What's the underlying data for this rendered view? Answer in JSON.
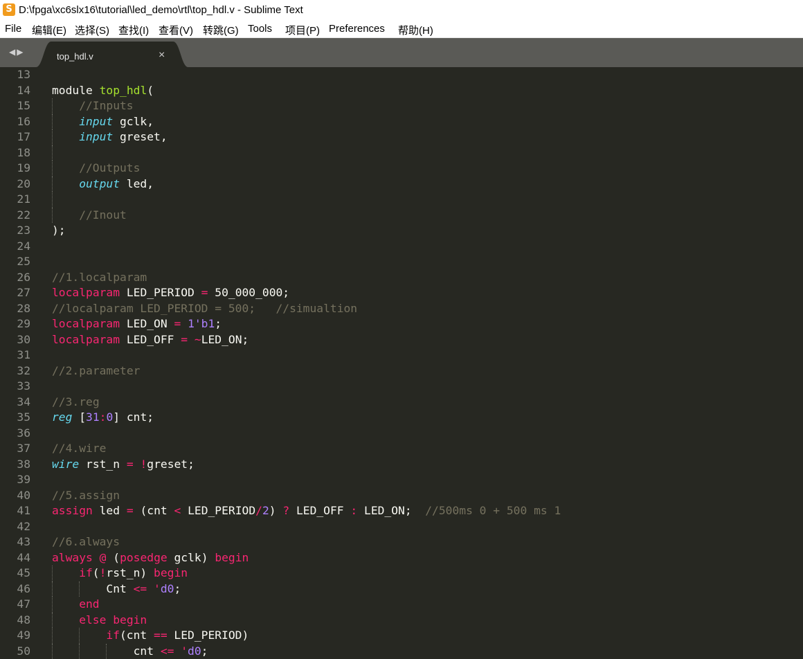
{
  "window": {
    "title": "D:\\fpga\\xc6slx16\\tutorial\\led_demo\\rtl\\top_hdl.v - Sublime Text",
    "icon_name": "sublime-text-logo-icon"
  },
  "menu": [
    "File",
    "编辑(E)",
    "选择(S)",
    "查找(I)",
    "查看(V)",
    "转跳(G)",
    "Tools",
    "项目(P)",
    "Preferences",
    "帮助(H)"
  ],
  "tabbar": {
    "nav_icon_names": [
      "left-arrow-icon",
      "right-arrow-icon"
    ],
    "tab_label": "top_hdl.v",
    "close_icon": "close-icon"
  },
  "colors": {
    "background": "#272822",
    "keyword": "#f92672",
    "storage": "#66d9ef",
    "function": "#a6e22e",
    "comment": "#75715e",
    "number": "#ae81ff",
    "text": "#f8f8f2"
  },
  "lines": [
    {
      "n": "13",
      "indent": 0,
      "tokens": []
    },
    {
      "n": "14",
      "indent": 0,
      "tokens": [
        [
          "t",
          "module "
        ],
        [
          "fn",
          "top_hdl"
        ],
        [
          "t",
          "("
        ]
      ]
    },
    {
      "n": "15",
      "indent": 1,
      "tokens": [
        [
          "cm",
          "//Inputs"
        ]
      ]
    },
    {
      "n": "16",
      "indent": 1,
      "tokens": [
        [
          "st",
          "input"
        ],
        [
          "t",
          " gclk,"
        ]
      ]
    },
    {
      "n": "17",
      "indent": 1,
      "tokens": [
        [
          "st",
          "input"
        ],
        [
          "t",
          " greset,"
        ]
      ]
    },
    {
      "n": "18",
      "indent": 1,
      "tokens": []
    },
    {
      "n": "19",
      "indent": 1,
      "tokens": [
        [
          "cm",
          "//Outputs"
        ]
      ]
    },
    {
      "n": "20",
      "indent": 1,
      "tokens": [
        [
          "st",
          "output"
        ],
        [
          "t",
          " led,"
        ]
      ]
    },
    {
      "n": "21",
      "indent": 1,
      "tokens": []
    },
    {
      "n": "22",
      "indent": 1,
      "tokens": [
        [
          "cm",
          "//Inout"
        ]
      ]
    },
    {
      "n": "23",
      "indent": 0,
      "tokens": [
        [
          "t",
          ");"
        ]
      ]
    },
    {
      "n": "24",
      "indent": 0,
      "tokens": []
    },
    {
      "n": "25",
      "indent": 0,
      "tokens": []
    },
    {
      "n": "26",
      "indent": 0,
      "tokens": [
        [
          "cm",
          "//1.localparam"
        ]
      ]
    },
    {
      "n": "27",
      "indent": 0,
      "tokens": [
        [
          "kw",
          "localparam"
        ],
        [
          "t",
          " LED_PERIOD "
        ],
        [
          "kw",
          "="
        ],
        [
          "t",
          " 50_000_000;"
        ]
      ]
    },
    {
      "n": "28",
      "indent": 0,
      "tokens": [
        [
          "cm",
          "//localparam LED_PERIOD = 500;   //simualtion"
        ]
      ]
    },
    {
      "n": "29",
      "indent": 0,
      "tokens": [
        [
          "kw",
          "localparam"
        ],
        [
          "t",
          " LED_ON "
        ],
        [
          "kw",
          "="
        ],
        [
          "t",
          " "
        ],
        [
          "nm",
          "1'b1"
        ],
        [
          "t",
          ";"
        ]
      ]
    },
    {
      "n": "30",
      "indent": 0,
      "tokens": [
        [
          "kw",
          "localparam"
        ],
        [
          "t",
          " LED_OFF "
        ],
        [
          "kw",
          "="
        ],
        [
          "t",
          " "
        ],
        [
          "kw",
          "~"
        ],
        [
          "t",
          "LED_ON;"
        ]
      ]
    },
    {
      "n": "31",
      "indent": 0,
      "tokens": []
    },
    {
      "n": "32",
      "indent": 0,
      "tokens": [
        [
          "cm",
          "//2.parameter"
        ]
      ]
    },
    {
      "n": "33",
      "indent": 0,
      "tokens": []
    },
    {
      "n": "34",
      "indent": 0,
      "tokens": [
        [
          "cm",
          "//3.reg"
        ]
      ]
    },
    {
      "n": "35",
      "indent": 0,
      "tokens": [
        [
          "st",
          "reg"
        ],
        [
          "t",
          " ["
        ],
        [
          "nm",
          "31"
        ],
        [
          "kw",
          ":"
        ],
        [
          "nm",
          "0"
        ],
        [
          "t",
          "] cnt;"
        ]
      ]
    },
    {
      "n": "36",
      "indent": 0,
      "tokens": []
    },
    {
      "n": "37",
      "indent": 0,
      "tokens": [
        [
          "cm",
          "//4.wire"
        ]
      ]
    },
    {
      "n": "38",
      "indent": 0,
      "tokens": [
        [
          "st",
          "wire"
        ],
        [
          "t",
          " rst_n "
        ],
        [
          "kw",
          "="
        ],
        [
          "t",
          " "
        ],
        [
          "kw",
          "!"
        ],
        [
          "t",
          "greset;"
        ]
      ]
    },
    {
      "n": "39",
      "indent": 0,
      "tokens": []
    },
    {
      "n": "40",
      "indent": 0,
      "tokens": [
        [
          "cm",
          "//5.assign"
        ]
      ]
    },
    {
      "n": "41",
      "indent": 0,
      "tokens": [
        [
          "kw",
          "assign"
        ],
        [
          "t",
          " led "
        ],
        [
          "kw",
          "="
        ],
        [
          "t",
          " (cnt "
        ],
        [
          "kw",
          "<"
        ],
        [
          "t",
          " LED_PERIOD"
        ],
        [
          "kw",
          "/"
        ],
        [
          "nm",
          "2"
        ],
        [
          "t",
          ") "
        ],
        [
          "kw",
          "?"
        ],
        [
          "t",
          " LED_OFF "
        ],
        [
          "kw",
          ":"
        ],
        [
          "t",
          " LED_ON;  "
        ],
        [
          "cm",
          "//500ms 0 + 500 ms 1"
        ]
      ]
    },
    {
      "n": "42",
      "indent": 0,
      "tokens": []
    },
    {
      "n": "43",
      "indent": 0,
      "tokens": [
        [
          "cm",
          "//6.always"
        ]
      ]
    },
    {
      "n": "44",
      "indent": 0,
      "tokens": [
        [
          "kw",
          "always"
        ],
        [
          "t",
          " "
        ],
        [
          "kw",
          "@"
        ],
        [
          "t",
          " ("
        ],
        [
          "kw",
          "posedge"
        ],
        [
          "t",
          " gclk) "
        ],
        [
          "kw",
          "begin"
        ]
      ]
    },
    {
      "n": "45",
      "indent": 1,
      "tokens": [
        [
          "kw",
          "if"
        ],
        [
          "t",
          "("
        ],
        [
          "kw",
          "!"
        ],
        [
          "t",
          "rst_n) "
        ],
        [
          "kw",
          "begin"
        ]
      ]
    },
    {
      "n": "46",
      "indent": 2,
      "tokens": [
        [
          "t",
          "Cnt "
        ],
        [
          "kw",
          "<="
        ],
        [
          "t",
          " "
        ],
        [
          "kw",
          "'"
        ],
        [
          "nm",
          "d0"
        ],
        [
          "t",
          ";"
        ]
      ]
    },
    {
      "n": "47",
      "indent": 1,
      "tokens": [
        [
          "kw",
          "end"
        ]
      ]
    },
    {
      "n": "48",
      "indent": 1,
      "tokens": [
        [
          "kw",
          "else"
        ],
        [
          "t",
          " "
        ],
        [
          "kw",
          "begin"
        ]
      ]
    },
    {
      "n": "49",
      "indent": 2,
      "tokens": [
        [
          "kw",
          "if"
        ],
        [
          "t",
          "(cnt "
        ],
        [
          "kw",
          "=="
        ],
        [
          "t",
          " LED_PERIOD)"
        ]
      ]
    },
    {
      "n": "50",
      "indent": 3,
      "tokens": [
        [
          "t",
          "cnt "
        ],
        [
          "kw",
          "<="
        ],
        [
          "t",
          " "
        ],
        [
          "kw",
          "'"
        ],
        [
          "nm",
          "d0"
        ],
        [
          "t",
          ";"
        ]
      ]
    }
  ]
}
